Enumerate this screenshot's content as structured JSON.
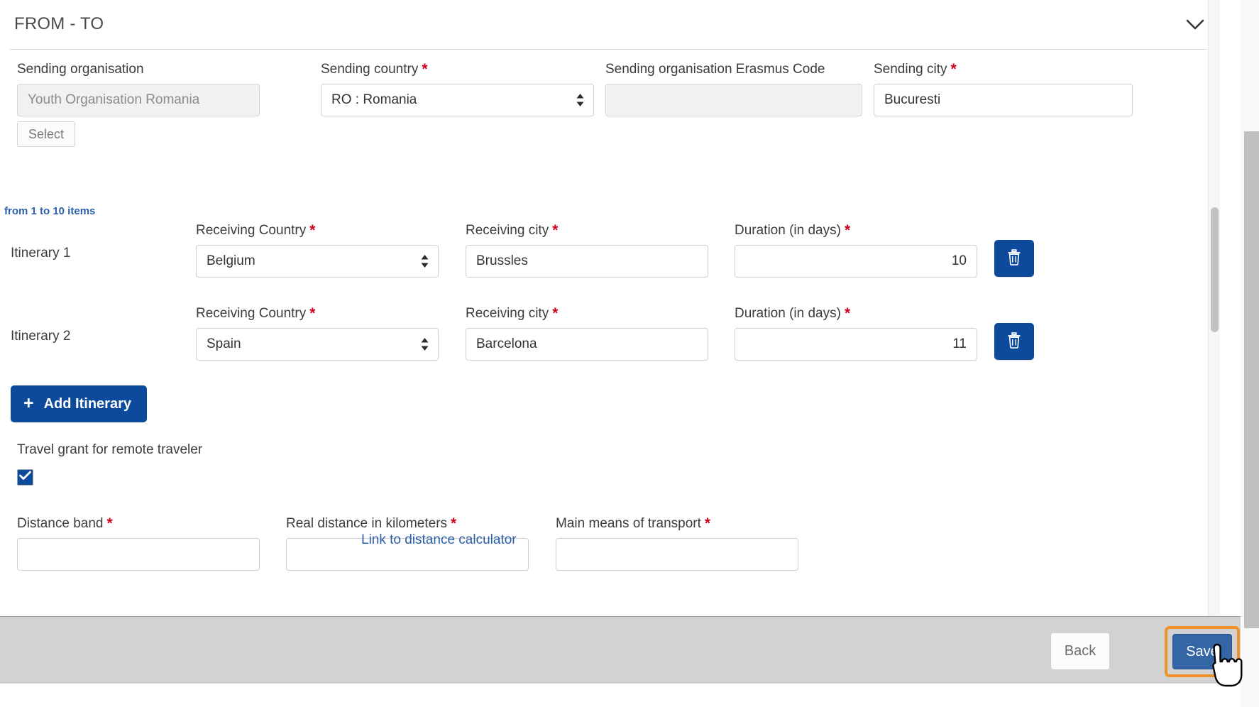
{
  "section": {
    "title": "FROM - TO",
    "collapse_icon": "chevron-down-icon"
  },
  "top_form": {
    "sending_organisation": {
      "label": "Sending organisation",
      "value": "Youth Organisation Romania",
      "required": false,
      "readonly": true,
      "select_button": "Select"
    },
    "sending_country": {
      "label": "Sending country",
      "value": "RO : Romania",
      "required": true,
      "marker": "*"
    },
    "sending_erasmus_code": {
      "label": "Sending organisation Erasmus Code",
      "value": "",
      "required": false,
      "readonly": true
    },
    "sending_city": {
      "label": "Sending city",
      "value": "Bucuresti",
      "required": true,
      "marker": "*"
    }
  },
  "items_counter": "from 1 to 10 items",
  "itinerary_headers": {
    "country": "Receiving Country",
    "city": "Receiving city",
    "duration": "Duration (in days)",
    "marker": "*"
  },
  "itineraries": [
    {
      "name": "Itinerary 1",
      "country": "Belgium",
      "city": "Brussles",
      "duration": "10",
      "delete_icon": "trash-icon"
    },
    {
      "name": "Itinerary 2",
      "country": "Spain",
      "city": "Barcelona",
      "duration": "11",
      "delete_icon": "trash-icon"
    }
  ],
  "add_itinerary": {
    "label": "Add Itinerary",
    "icon": "plus-icon"
  },
  "travel_grant": {
    "label": "Travel grant for remote traveler",
    "checked": true,
    "check_icon": "check-icon"
  },
  "bottom_form": {
    "distance_band": {
      "label": "Distance band",
      "marker": "*",
      "value": ""
    },
    "real_distance": {
      "label": "Real distance in kilometers",
      "marker": "*",
      "value": ""
    },
    "distance_calculator_link": "Link to distance calculator",
    "main_transport": {
      "label": "Main means of transport",
      "marker": "*",
      "value": ""
    }
  },
  "action_bar": {
    "back_label": "Back",
    "save_label": "Save"
  },
  "colors": {
    "primary_blue": "#0d4a9b",
    "save_blue": "#3465a4",
    "highlight_orange": "#f0922b",
    "required_red": "#d0021b",
    "link_blue": "#2b5fa8",
    "action_bar_gray": "#d2d2d2"
  }
}
